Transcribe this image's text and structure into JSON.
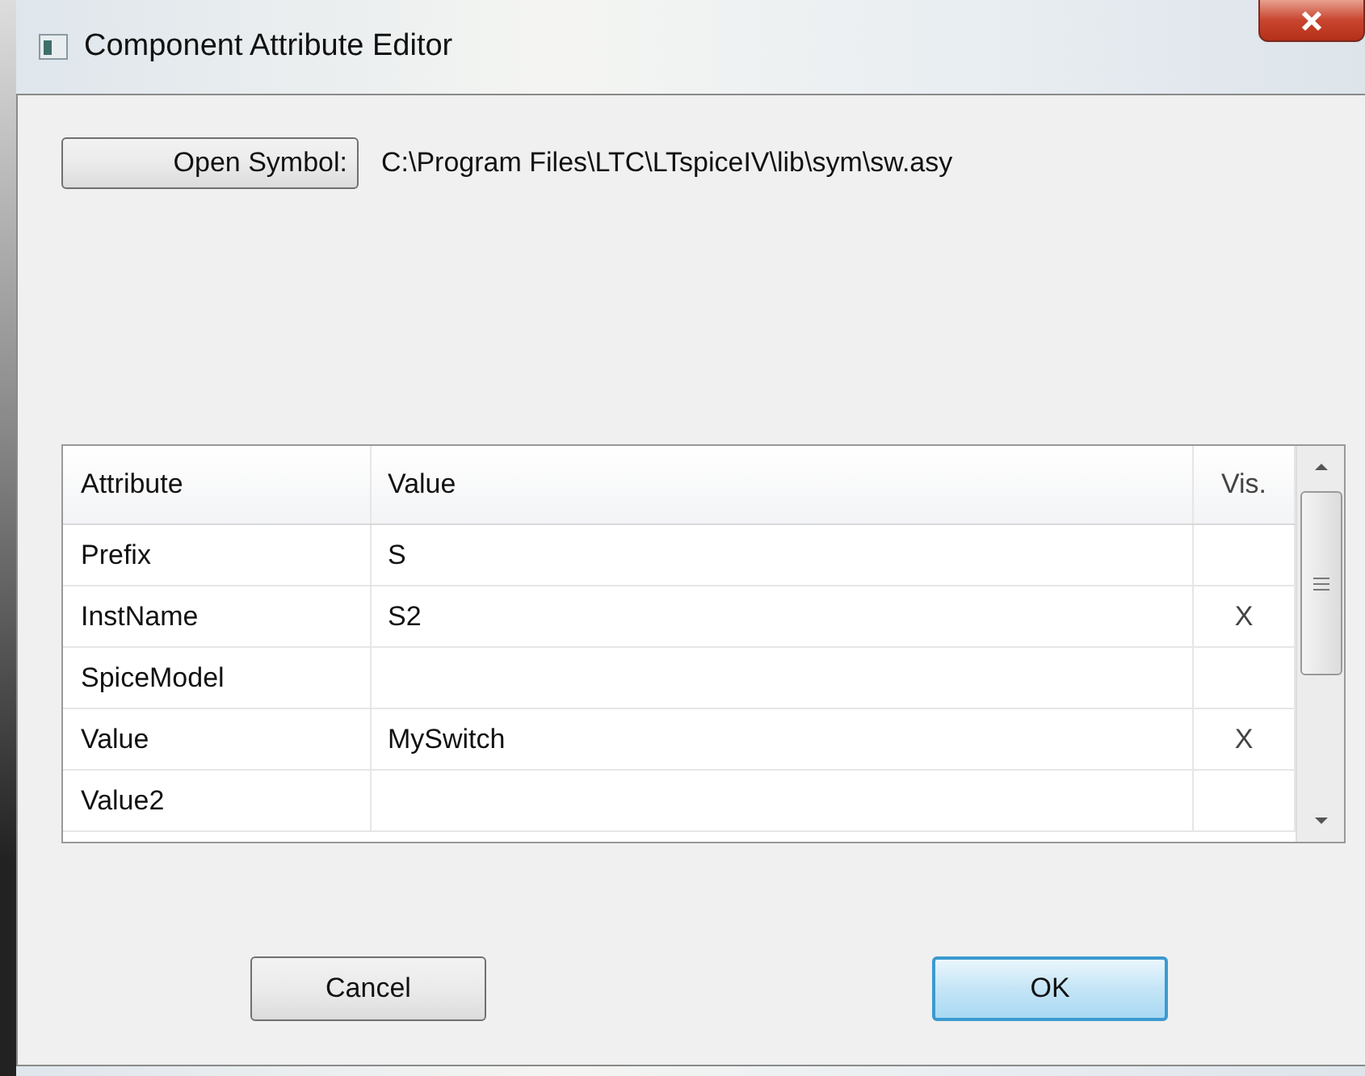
{
  "window": {
    "title": "Component Attribute Editor"
  },
  "open_symbol": {
    "button": "Open Symbol:",
    "path": "C:\\Program Files\\LTC\\LTspiceIV\\lib\\sym\\sw.asy"
  },
  "table": {
    "columns": [
      "Attribute",
      "Value",
      "Vis."
    ],
    "rows": [
      {
        "attribute": "Prefix",
        "value": "S"
      },
      {
        "attribute": "InstName",
        "value": "S2",
        "vis": "X"
      },
      {
        "attribute": "SpiceModel"
      },
      {
        "attribute": "Value",
        "value": "MySwitch",
        "vis": "X"
      },
      {
        "attribute": "Value2"
      }
    ]
  },
  "buttons": [
    {
      "label": "Cancel",
      "default": false
    },
    {
      "label": "OK",
      "default": true
    }
  ]
}
